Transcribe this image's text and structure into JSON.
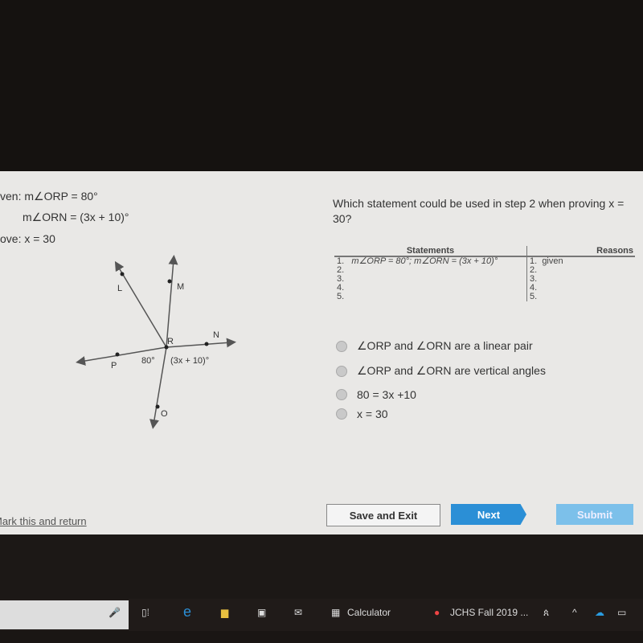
{
  "given": {
    "line1": "ven: m∠ORP = 80°",
    "line2": "m∠ORN = (3x + 10)°",
    "prove": "ove: x = 30"
  },
  "diagram": {
    "labels": {
      "L": "L",
      "M": "M",
      "R": "R",
      "N": "N",
      "P": "P",
      "O": "O",
      "angle1": "80°",
      "angle2": "(3x + 10)°"
    }
  },
  "question": "Which statement could be used in step 2 when proving x = 30?",
  "proof": {
    "headers": {
      "statements": "Statements",
      "reasons": "Reasons"
    },
    "rows": [
      {
        "n": "1.",
        "statement": "m∠ORP = 80°; m∠ORN = (3x + 10)°",
        "rn": "1.",
        "reason": "given"
      },
      {
        "n": "2.",
        "statement": "",
        "rn": "2.",
        "reason": ""
      },
      {
        "n": "3.",
        "statement": "",
        "rn": "3.",
        "reason": ""
      },
      {
        "n": "4.",
        "statement": "",
        "rn": "4.",
        "reason": ""
      },
      {
        "n": "5.",
        "statement": "",
        "rn": "5.",
        "reason": ""
      }
    ]
  },
  "options": [
    "∠ORP and ∠ORN are a linear pair",
    "∠ORP and ∠ORN are vertical angles",
    "80 = 3x +10",
    "x = 30"
  ],
  "mark_link": "Mark this and return",
  "buttons": {
    "save": "Save and Exit",
    "next": "Next",
    "submit": "Submit"
  },
  "taskbar": {
    "calculator": "Calculator",
    "chrome": "JCHS Fall 2019 ..."
  },
  "colors": {
    "next": "#2b8fd6",
    "submit": "#7cc0ea"
  }
}
